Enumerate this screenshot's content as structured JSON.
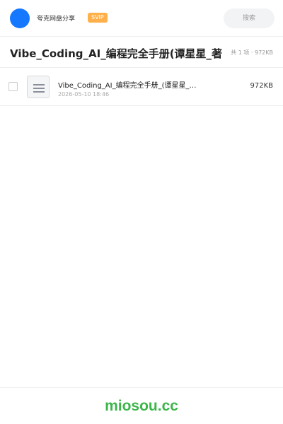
{
  "header": {
    "user_name": "夸克网盘分享",
    "vip_badge": "SVIP",
    "search_label": "搜索",
    "colors": {
      "avatar": "#1677ff",
      "vip": "#ffb04a"
    }
  },
  "folder": {
    "title": "Vibe_Coding_AI_编程完全手册(谭星星_著)",
    "summary": "共 1 项 · 972KB"
  },
  "files": [
    {
      "name": "Vibe_Coding_AI_编程完全手册_(谭星星_著).pdf",
      "date": "2026-05-10 18:46",
      "size": "972KB",
      "icon": "document-icon"
    }
  ],
  "footer": {
    "brand": "miosou.cc",
    "brand_color": "#3cb54a"
  }
}
